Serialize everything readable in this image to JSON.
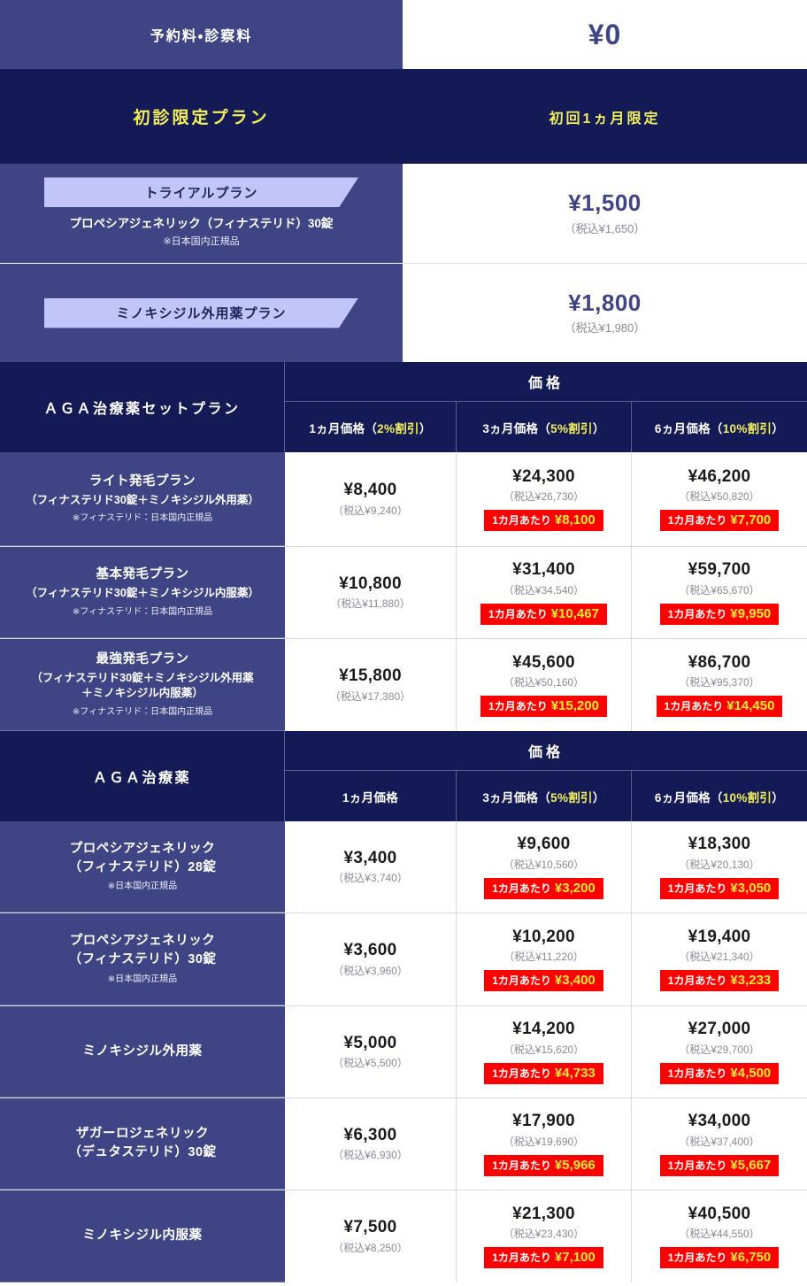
{
  "consultation": {
    "label": "予約料・診察料",
    "value": "¥0"
  },
  "first_visit": {
    "label": "初診限定プラン",
    "value_header": "初回1ヵ月限定",
    "plans": [
      {
        "ribbon": "トライアルプラン",
        "sub": "プロペシアジェネリック（フィナステリド）30錠",
        "note": "※日本国内正規品",
        "price": "¥1,500",
        "tax": "（税込¥1,650）"
      },
      {
        "ribbon": "ミノキシジル外用薬プラン",
        "sub": "",
        "note": "",
        "price": "¥1,800",
        "tax": "（税込¥1,980）"
      }
    ]
  },
  "set_plan_table": {
    "title": "ＡＧＡ治療薬セットプラン",
    "price_header": "価格",
    "columns": [
      {
        "label": "1ヵ月価格（",
        "highlight": "2%割引",
        "tail": "）"
      },
      {
        "label": "3ヵ月価格（",
        "highlight": "5%割引",
        "tail": "）"
      },
      {
        "label": "6ヵ月価格（",
        "highlight": "10%割引",
        "tail": "）"
      }
    ],
    "rows": [
      {
        "name": "ライト発毛プラン",
        "sub": "（フィナステリド30錠＋ミノキシジル外用薬）",
        "note": "※フィナステリド：日本国内正規品",
        "cells": [
          {
            "price": "¥8,400",
            "tax": "（税込¥9,240）",
            "badge_label": "",
            "badge_value": ""
          },
          {
            "price": "¥24,300",
            "tax": "（税込¥26,730）",
            "badge_label": "1カ月あたり",
            "badge_value": "¥8,100"
          },
          {
            "price": "¥46,200",
            "tax": "（税込¥50,820）",
            "badge_label": "1カ月あたり",
            "badge_value": "¥7,700"
          }
        ]
      },
      {
        "name": "基本発毛プラン",
        "sub": "（フィナステリド30錠＋ミノキシジル内服薬）",
        "note": "※フィナステリド：日本国内正規品",
        "cells": [
          {
            "price": "¥10,800",
            "tax": "（税込¥11,880）",
            "badge_label": "",
            "badge_value": ""
          },
          {
            "price": "¥31,400",
            "tax": "（税込¥34,540）",
            "badge_label": "1カ月あたり",
            "badge_value": "¥10,467"
          },
          {
            "price": "¥59,700",
            "tax": "（税込¥65,670）",
            "badge_label": "1カ月あたり",
            "badge_value": "¥9,950"
          }
        ]
      },
      {
        "name": "最強発毛プラン",
        "sub": "（フィナステリド30錠＋ミノキシジル外用薬\n＋ミノキシジル内服薬）",
        "note": "※フィナステリド：日本国内正規品",
        "cells": [
          {
            "price": "¥15,800",
            "tax": "（税込¥17,380）",
            "badge_label": "",
            "badge_value": ""
          },
          {
            "price": "¥45,600",
            "tax": "（税込¥50,160）",
            "badge_label": "1カ月あたり",
            "badge_value": "¥15,200"
          },
          {
            "price": "¥86,700",
            "tax": "（税込¥95,370）",
            "badge_label": "1カ月あたり",
            "badge_value": "¥14,450"
          }
        ]
      }
    ]
  },
  "drug_table": {
    "title": "ＡＧＡ治療薬",
    "price_header": "価格",
    "columns": [
      {
        "label": "1ヵ月価格",
        "highlight": "",
        "tail": ""
      },
      {
        "label": "3ヵ月価格（",
        "highlight": "5%割引",
        "tail": "）"
      },
      {
        "label": "6ヵ月価格（",
        "highlight": "10%割引",
        "tail": "）"
      }
    ],
    "rows": [
      {
        "name": "プロペシアジェネリック\n（フィナステリド）28錠",
        "sub": "",
        "note": "※日本国内正規品",
        "cells": [
          {
            "price": "¥3,400",
            "tax": "（税込¥3,740）",
            "badge_label": "",
            "badge_value": ""
          },
          {
            "price": "¥9,600",
            "tax": "（税込¥10,560）",
            "badge_label": "1カ月あたり",
            "badge_value": "¥3,200"
          },
          {
            "price": "¥18,300",
            "tax": "（税込¥20,130）",
            "badge_label": "1カ月あたり",
            "badge_value": "¥3,050"
          }
        ]
      },
      {
        "name": "プロペシアジェネリック\n（フィナステリド）30錠",
        "sub": "",
        "note": "※日本国内正規品",
        "cells": [
          {
            "price": "¥3,600",
            "tax": "（税込¥3,960）",
            "badge_label": "",
            "badge_value": ""
          },
          {
            "price": "¥10,200",
            "tax": "（税込¥11,220）",
            "badge_label": "1カ月あたり",
            "badge_value": "¥3,400"
          },
          {
            "price": "¥19,400",
            "tax": "（税込¥21,340）",
            "badge_label": "1カ月あたり",
            "badge_value": "¥3,233"
          }
        ]
      },
      {
        "name": "ミノキシジル外用薬",
        "sub": "",
        "note": "",
        "cells": [
          {
            "price": "¥5,000",
            "tax": "（税込¥5,500）",
            "badge_label": "",
            "badge_value": ""
          },
          {
            "price": "¥14,200",
            "tax": "（税込¥15,620）",
            "badge_label": "1カ月あたり",
            "badge_value": "¥4,733"
          },
          {
            "price": "¥27,000",
            "tax": "（税込¥29,700）",
            "badge_label": "1カ月あたり",
            "badge_value": "¥4,500"
          }
        ]
      },
      {
        "name": "ザガーロジェネリック\n（デュタステリド）30錠",
        "sub": "",
        "note": "",
        "cells": [
          {
            "price": "¥6,300",
            "tax": "（税込¥6,930）",
            "badge_label": "",
            "badge_value": ""
          },
          {
            "price": "¥17,900",
            "tax": "（税込¥19,690）",
            "badge_label": "1カ月あたり",
            "badge_value": "¥5,966"
          },
          {
            "price": "¥34,000",
            "tax": "（税込¥37,400）",
            "badge_label": "1カ月あたり",
            "badge_value": "¥5,667"
          }
        ]
      },
      {
        "name": "ミノキシジル内服薬",
        "sub": "",
        "note": "",
        "cells": [
          {
            "price": "¥7,500",
            "tax": "（税込¥8,250）",
            "badge_label": "",
            "badge_value": ""
          },
          {
            "price": "¥21,300",
            "tax": "（税込¥23,430）",
            "badge_label": "1カ月あたり",
            "badge_value": "¥7,100"
          },
          {
            "price": "¥40,500",
            "tax": "（税込¥44,550）",
            "badge_label": "1カ月あたり",
            "badge_value": "¥6,750"
          }
        ]
      }
    ]
  },
  "colors": {
    "indigo": "#3f4484",
    "navy": "#141a55",
    "ribbon": "#c2c5fa",
    "yellow": "#f2ef5a",
    "badge_red": "#ff0000",
    "badge_yellow": "#f2ef2f"
  }
}
